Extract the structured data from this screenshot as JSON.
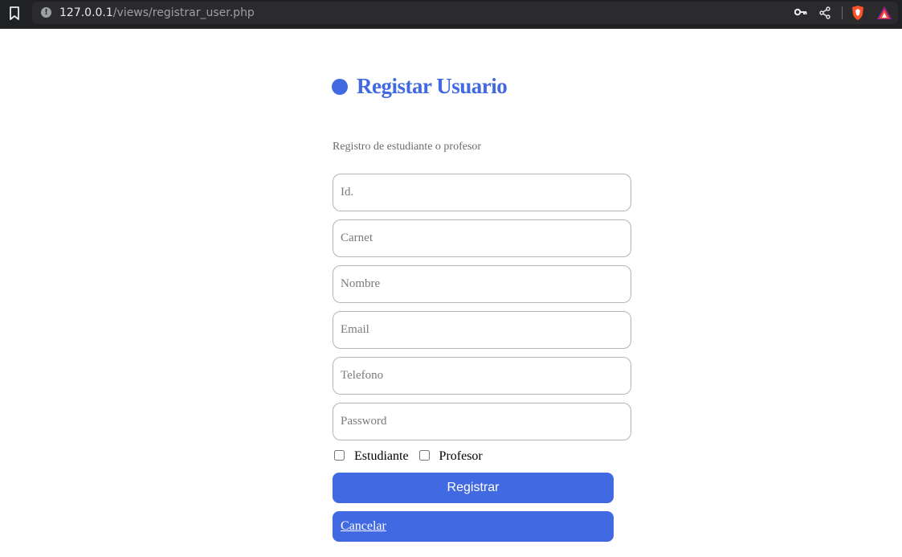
{
  "browser": {
    "url_host": "127.0.0.1",
    "url_path": "/views/registrar_user.php",
    "info_glyph": "!",
    "icons": [
      "bookmark-icon",
      "info-icon",
      "key-icon",
      "share-icon",
      "brave-shield-icon",
      "brave-rewards-icon"
    ]
  },
  "page": {
    "title": "Registar Usuario",
    "subtitle": "Registro de estudiante o profesor",
    "accent_color": "#4169e1"
  },
  "form": {
    "fields": [
      {
        "placeholder": "Id.",
        "value": ""
      },
      {
        "placeholder": "Carnet",
        "value": ""
      },
      {
        "placeholder": "Nombre",
        "value": ""
      },
      {
        "placeholder": "Email",
        "value": ""
      },
      {
        "placeholder": "Telefono",
        "value": ""
      },
      {
        "placeholder": "Password",
        "value": ""
      }
    ],
    "checkboxes": [
      {
        "label": "Estudiante",
        "checked": false
      },
      {
        "label": "Profesor",
        "checked": false
      }
    ],
    "submit_label": "Registrar",
    "cancel_label": "Cancelar"
  }
}
